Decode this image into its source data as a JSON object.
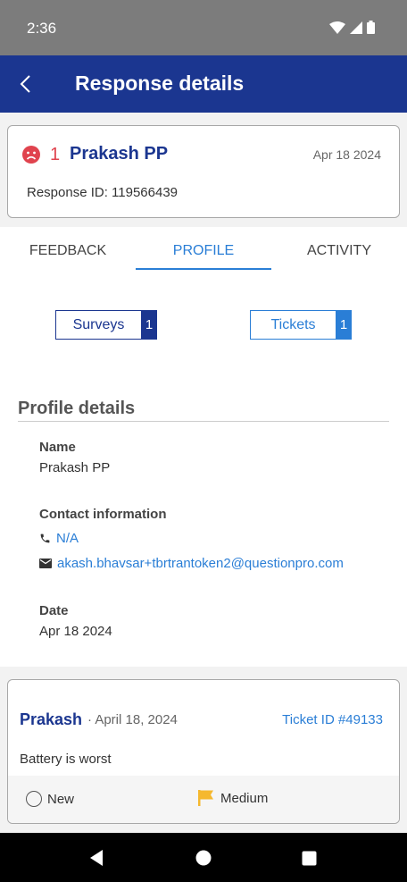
{
  "status_bar": {
    "time": "2:36"
  },
  "app_bar": {
    "title": "Response details"
  },
  "response": {
    "count": "1",
    "name": "Prakash PP",
    "date": "Apr 18 2024",
    "id_text": "Response ID: 119566439",
    "sentiment_icon": "sad-face-icon"
  },
  "tabs": [
    {
      "label": "FEEDBACK",
      "active": false
    },
    {
      "label": "PROFILE",
      "active": true
    },
    {
      "label": "ACTIVITY",
      "active": false
    }
  ],
  "chips": {
    "surveys": {
      "label": "Surveys",
      "count": "1"
    },
    "tickets": {
      "label": "Tickets",
      "count": "1"
    }
  },
  "profile": {
    "section_title": "Profile details",
    "name_label": "Name",
    "name_value": "Prakash PP",
    "contact_label": "Contact information",
    "phone": "N/A",
    "email": "akash.bhavsar+tbrtrantoken2@questionpro.com",
    "date_label": "Date",
    "date_value": "Apr 18 2024"
  },
  "ticket": {
    "name": "Prakash",
    "date": "· April 18, 2024",
    "id": "Ticket ID #49133",
    "text": "Battery is worst",
    "status": "New",
    "priority": "Medium"
  },
  "colors": {
    "brand": "#1b3690",
    "accent": "#2a7ed6",
    "negative": "#e0434e",
    "priority_flag": "#f5b82e"
  }
}
